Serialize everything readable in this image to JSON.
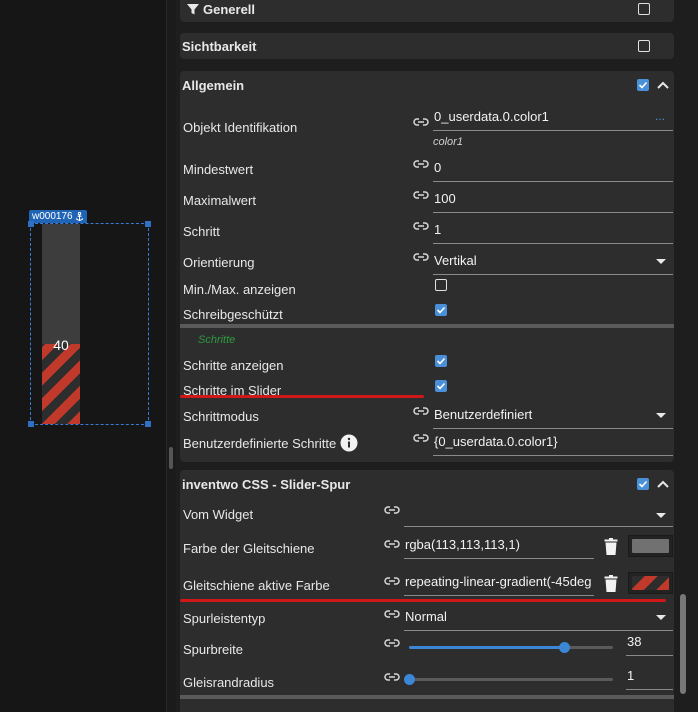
{
  "canvas": {
    "widget_id": "w000176",
    "slider_value": "40"
  },
  "sections": {
    "generell": {
      "title": "Generell"
    },
    "sichtbarkeit": {
      "title": "Sichtbarkeit"
    },
    "allgemein": {
      "title": "Allgemein",
      "rows": {
        "oid_label": "Objekt Identifikation",
        "oid_value": "0_userdata.0.color1",
        "oid_hint": "color1",
        "oid_more": "...",
        "min_label": "Mindestwert",
        "min_value": "0",
        "max_label": "Maximalwert",
        "max_value": "100",
        "step_label": "Schritt",
        "step_value": "1",
        "orient_label": "Orientierung",
        "orient_value": "Vertikal",
        "minmax_label": "Min./Max. anzeigen",
        "readonly_label": "Schreibgeschützt",
        "group_title": "Schritte",
        "showsteps_label": "Schritte anzeigen",
        "stepsslider_label": "Schritte im Slider",
        "stepmode_label": "Schrittmodus",
        "stepmode_value": "Benutzerdefiniert",
        "customsteps_label": "Benutzerdefinierte Schritte",
        "customsteps_value": "{0_userdata.0.color1}"
      }
    },
    "inventwo": {
      "title": "inventwo CSS - Slider-Spur",
      "rows": {
        "fromwidget_label": "Vom Widget",
        "fromwidget_value": "",
        "trackcolor_label": "Farbe der Gleitschiene",
        "trackcolor_value": "rgba(113,113,113,1)",
        "activecolor_label": "Gleitschiene aktive Farbe",
        "activecolor_value": "repeating-linear-gradient(-45deg",
        "tracktype_label": "Spurleistentyp",
        "tracktype_value": "Normal",
        "trackwidth_label": "Spurbreite",
        "trackwidth_value": "38",
        "trackradius_label": "Gleisrandradius",
        "trackradius_value": "1"
      }
    }
  },
  "sliders": {
    "trackwidth_fraction": 0.76,
    "trackradius_fraction": 0.0
  },
  "colors": {
    "accent": "#4a90d9",
    "annotation_red": "#d01818",
    "group_green": "#2e9a3e",
    "track_gray": "#717171",
    "active_red": "#c0392b"
  },
  "icons": {
    "filter": "filter-icon",
    "link": "link-icon",
    "trash": "trash-icon",
    "chevron_up": "chevron-up-icon",
    "caret_down": "caret-down-icon",
    "info": "info-icon",
    "anchor": "anchor-icon"
  }
}
